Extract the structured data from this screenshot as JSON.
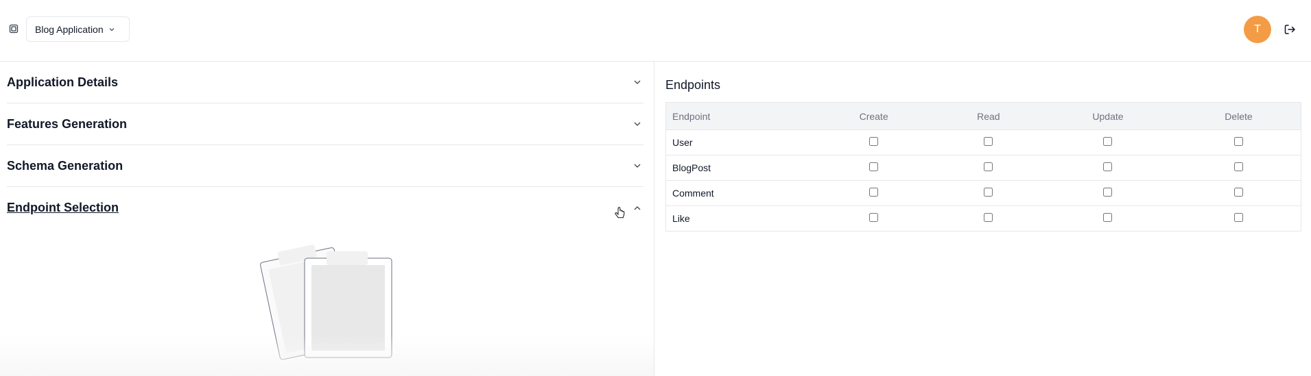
{
  "header": {
    "app_selector_label": "Blog Application",
    "avatar_initial": "T"
  },
  "accordion": {
    "items": [
      {
        "label": "Application Details",
        "expanded": false
      },
      {
        "label": "Features Generation",
        "expanded": false
      },
      {
        "label": "Schema Generation",
        "expanded": false
      },
      {
        "label": "Endpoint Selection",
        "expanded": true
      }
    ]
  },
  "endpoints": {
    "title": "Endpoints",
    "columns": [
      "Endpoint",
      "Create",
      "Read",
      "Update",
      "Delete"
    ],
    "rows": [
      {
        "name": "User",
        "create": false,
        "read": false,
        "update": false,
        "delete": false
      },
      {
        "name": "BlogPost",
        "create": false,
        "read": false,
        "update": false,
        "delete": false
      },
      {
        "name": "Comment",
        "create": false,
        "read": false,
        "update": false,
        "delete": false
      },
      {
        "name": "Like",
        "create": false,
        "read": false,
        "update": false,
        "delete": false
      }
    ]
  },
  "colors": {
    "avatar_bg": "#f39c45",
    "table_header_bg": "#f3f4f6",
    "border": "#e5e7eb"
  }
}
